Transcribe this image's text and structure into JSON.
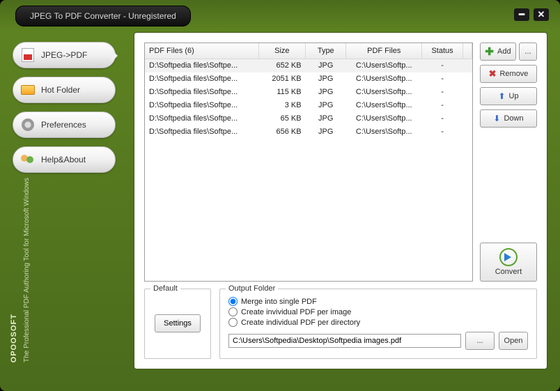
{
  "window": {
    "title": "JPEG To PDF Converter - Unregistered"
  },
  "sidebar": {
    "items": [
      {
        "label": "JPEG->PDF"
      },
      {
        "label": "Hot Folder"
      },
      {
        "label": "Preferences"
      },
      {
        "label": "Help&About"
      }
    ],
    "tagline": "The Professional PDF Authoring Tool\nfor Microsoft Windows",
    "brand": "OPOOSOFT"
  },
  "table": {
    "headers": {
      "file": "PDF Files (6)",
      "size": "Size",
      "type": "Type",
      "pdf": "PDF Files",
      "status": "Status"
    },
    "rows": [
      {
        "file": "D:\\Softpedia files\\Softpe...",
        "size": "652 KB",
        "type": "JPG",
        "pdf": "C:\\Users\\Softp...",
        "status": "-"
      },
      {
        "file": "D:\\Softpedia files\\Softpe...",
        "size": "2051 KB",
        "type": "JPG",
        "pdf": "C:\\Users\\Softp...",
        "status": "-"
      },
      {
        "file": "D:\\Softpedia files\\Softpe...",
        "size": "115 KB",
        "type": "JPG",
        "pdf": "C:\\Users\\Softp...",
        "status": "-"
      },
      {
        "file": "D:\\Softpedia files\\Softpe...",
        "size": "3 KB",
        "type": "JPG",
        "pdf": "C:\\Users\\Softp...",
        "status": "-"
      },
      {
        "file": "D:\\Softpedia files\\Softpe...",
        "size": "65 KB",
        "type": "JPG",
        "pdf": "C:\\Users\\Softp...",
        "status": "-"
      },
      {
        "file": "D:\\Softpedia files\\Softpe...",
        "size": "656 KB",
        "type": "JPG",
        "pdf": "C:\\Users\\Softp...",
        "status": "-"
      }
    ]
  },
  "actions": {
    "add": "Add",
    "more": "...",
    "remove": "Remove",
    "up": "Up",
    "down": "Down",
    "convert": "Convert"
  },
  "default_group": {
    "legend": "Default",
    "settings": "Settings"
  },
  "output": {
    "legend": "Output Folder",
    "opt_merge": "Merge into single PDF",
    "opt_per_image": "Create invividual PDF per image",
    "opt_per_dir": "Create individual PDF per directory",
    "path": "C:\\Users\\Softpedia\\Desktop\\Softpedia images.pdf",
    "browse": "...",
    "open": "Open"
  }
}
